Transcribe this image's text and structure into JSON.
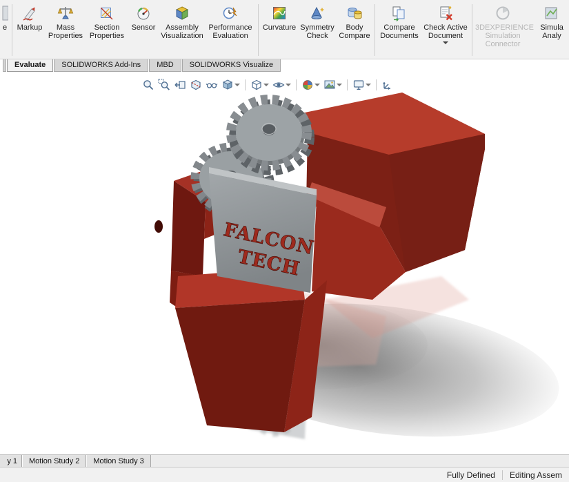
{
  "colors": {
    "toolbar_bg": "#f1f1f1",
    "model_red_top": "#b63c2b",
    "model_red_front": "#701a10",
    "gear_gray": "#9aa0a3",
    "accent_blue": "#5d87c5",
    "brand_text_red": "#9e2a1e"
  },
  "ribbon": {
    "items": [
      {
        "label": "e",
        "icon": "clipped-left-icon"
      },
      {
        "label": "Markup",
        "icon": "markup-icon"
      },
      {
        "label": "Mass Properties",
        "icon": "mass-properties-icon"
      },
      {
        "label": "Section Properties",
        "icon": "section-properties-icon"
      },
      {
        "label": "Sensor",
        "icon": "sensor-icon"
      },
      {
        "label": "Assembly Visualization",
        "icon": "assembly-visualization-icon"
      },
      {
        "label": "Performance Evaluation",
        "icon": "performance-evaluation-icon"
      },
      {
        "label": "Curvature",
        "icon": "curvature-icon"
      },
      {
        "label": "Symmetry Check",
        "icon": "symmetry-check-icon"
      },
      {
        "label": "Body Compare",
        "icon": "body-compare-icon"
      },
      {
        "label": "Compare Documents",
        "icon": "compare-documents-icon"
      },
      {
        "label": "Check Active Document",
        "icon": "check-active-document-icon",
        "has_dropdown": true
      },
      {
        "label": "3DEXPERIENCE Simulation Connector",
        "icon": "3dexperience-connector-icon",
        "disabled": true
      },
      {
        "label": "Simula Analy",
        "icon": "simulation-analysis-icon"
      }
    ]
  },
  "command_tabs": [
    {
      "label": "Evaluate",
      "active": true
    },
    {
      "label": "SOLIDWORKS Add-Ins",
      "active": false
    },
    {
      "label": "MBD",
      "active": false
    },
    {
      "label": "SOLIDWORKS Visualize",
      "active": false
    }
  ],
  "heads_up_toolbar": {
    "buttons": [
      {
        "icon": "zoom-to-fit-icon"
      },
      {
        "icon": "zoom-to-area-icon"
      },
      {
        "icon": "previous-view-icon"
      },
      {
        "icon": "section-view-icon"
      },
      {
        "icon": "dynamic-annotation-views-icon"
      },
      {
        "icon": "view-orientation-icon",
        "has_dropdown": true
      },
      {
        "icon": "display-style-icon",
        "has_dropdown": true
      },
      {
        "icon": "hide-show-items-icon",
        "has_dropdown": true
      },
      {
        "icon": "edit-appearance-icon",
        "has_dropdown": true
      },
      {
        "icon": "apply-scene-icon",
        "has_dropdown": true
      },
      {
        "icon": "view-settings-icon",
        "has_dropdown": true
      },
      {
        "icon": "orientation-triad-icon"
      }
    ]
  },
  "viewport": {
    "model": {
      "brand_line1": "FALCON",
      "brand_line2": "TECH"
    }
  },
  "motion_bar": {
    "tabs": [
      {
        "label": "y 1"
      },
      {
        "label": "Motion Study 2"
      },
      {
        "label": "Motion Study 3"
      }
    ]
  },
  "status_bar": {
    "assembly_state": "Fully Defined",
    "mode": "Editing Assem"
  }
}
